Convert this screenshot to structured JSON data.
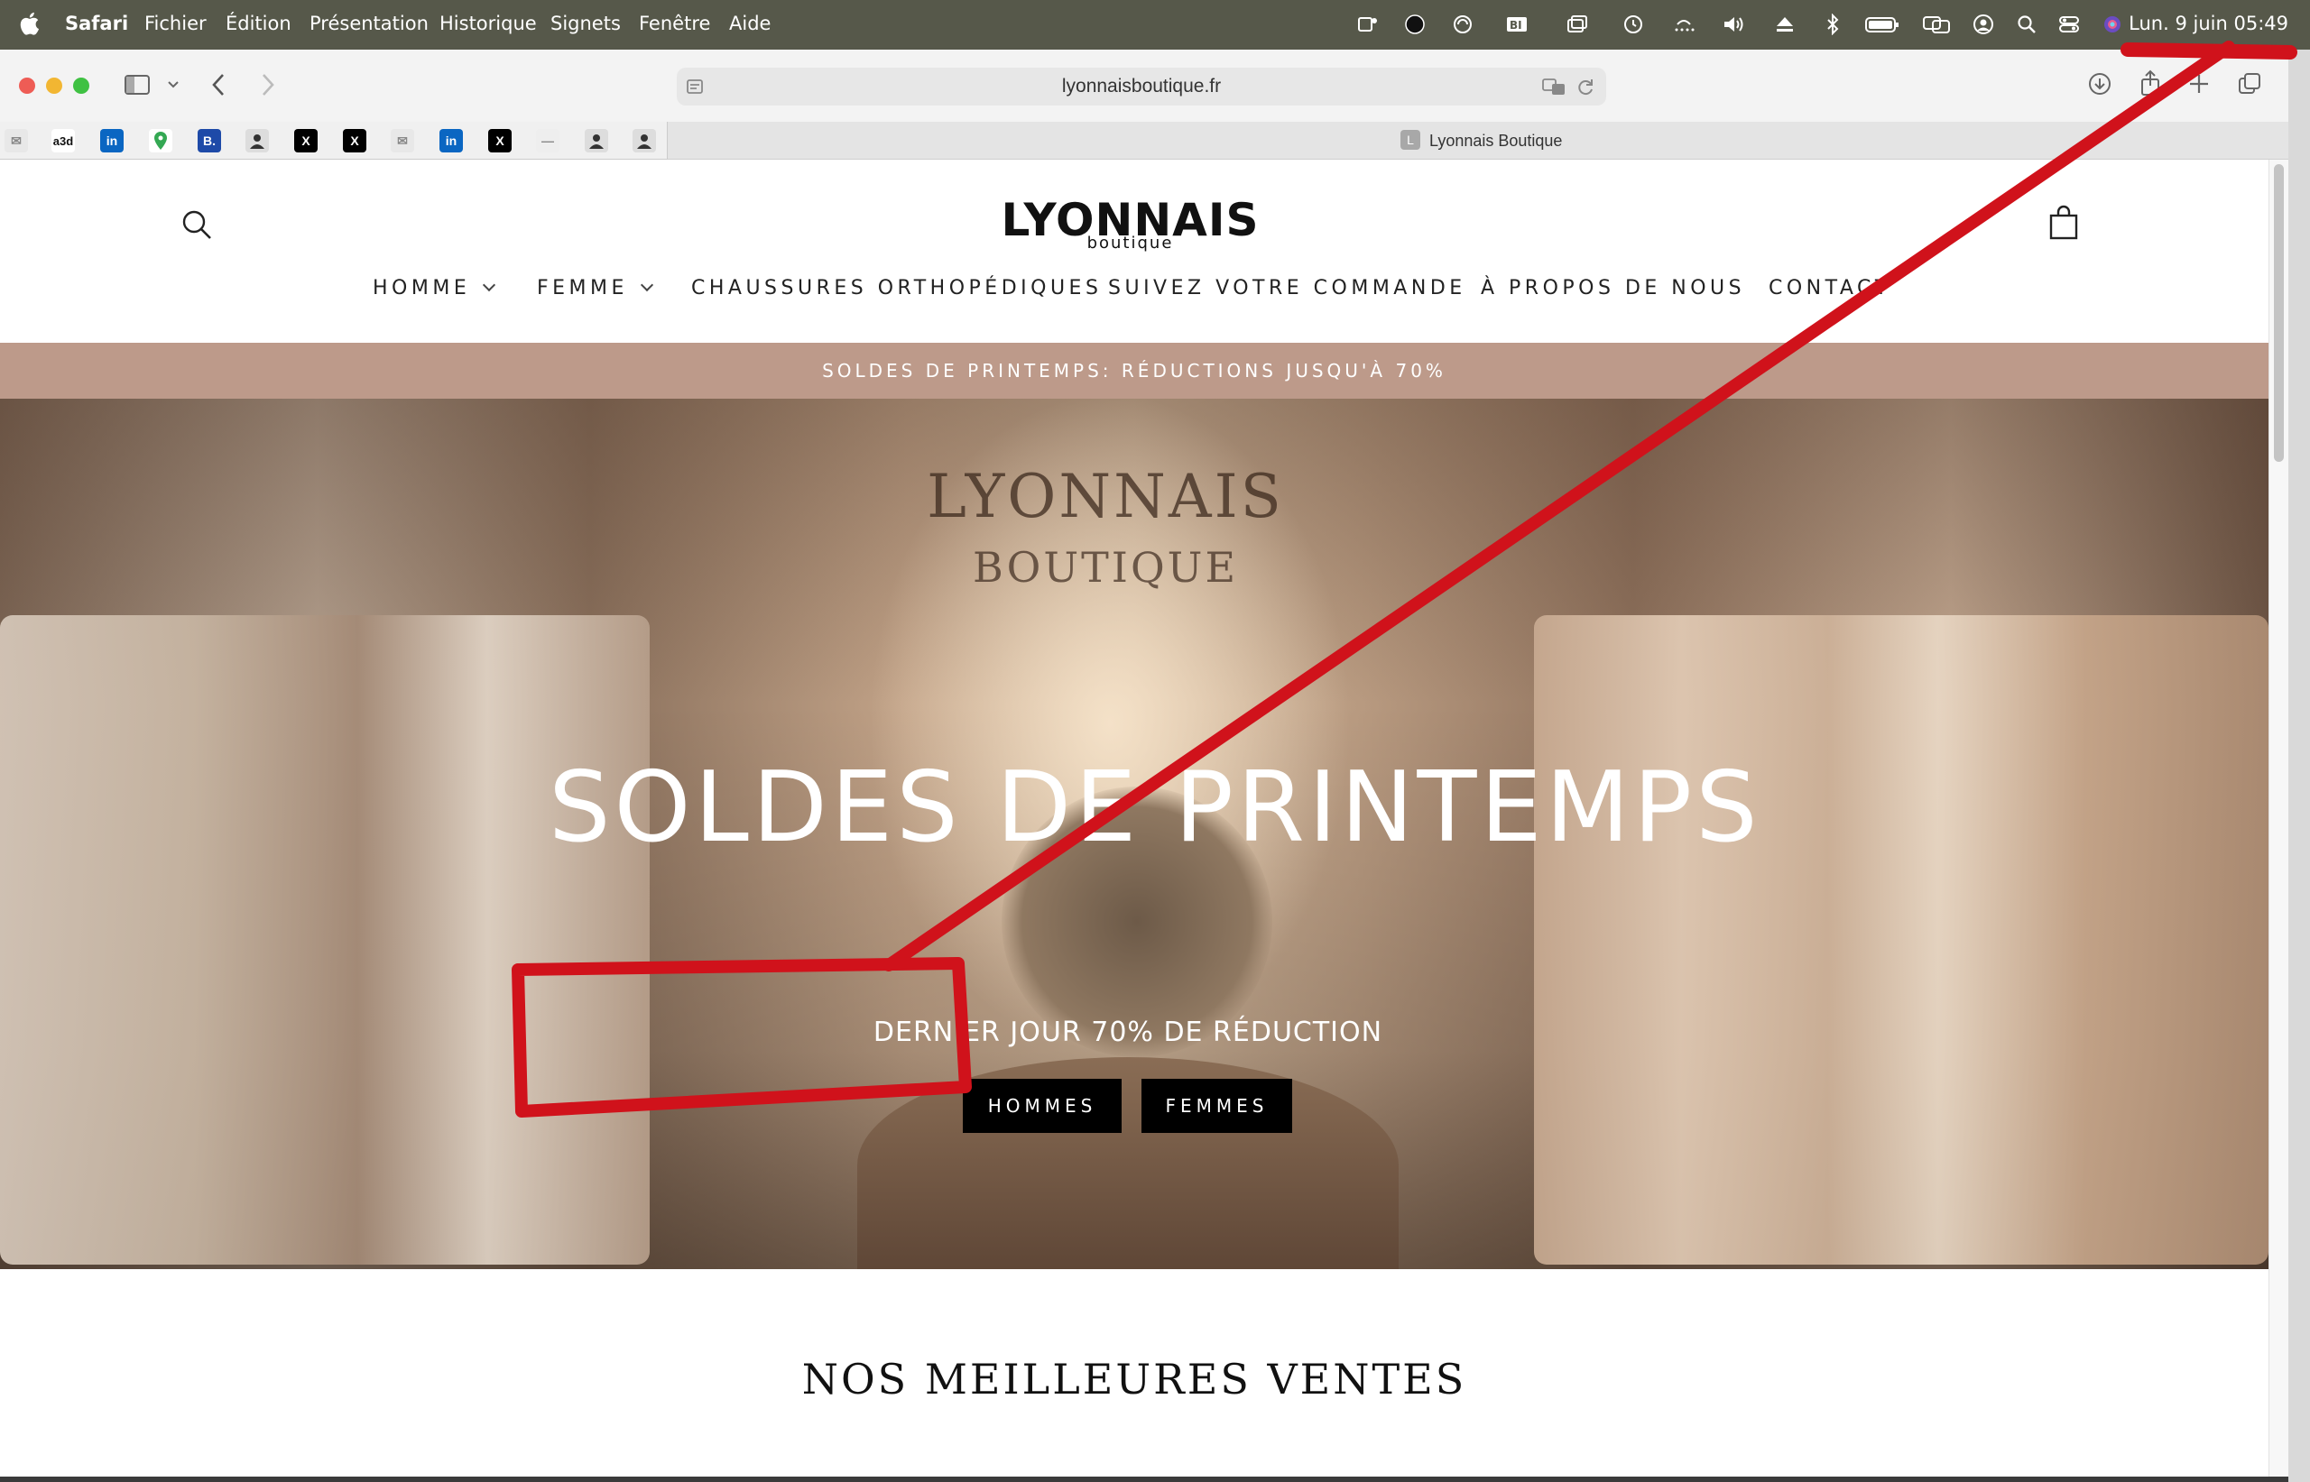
{
  "menubar": {
    "app": "Safari",
    "items": [
      "Fichier",
      "Édition",
      "Présentation",
      "Historique",
      "Signets",
      "Fenêtre",
      "Aide"
    ],
    "clock": "Lun. 9 juin  05:49"
  },
  "browser": {
    "url": "lyonnaisboutique.fr",
    "tab_title": "Lyonnais Boutique",
    "tab_favicon": "L",
    "favorites": [
      "a3d"
    ]
  },
  "site": {
    "logo": "LYONNAIS",
    "logo_sub": "boutique",
    "nav": {
      "homme": "HOMME",
      "femme": "FEMME",
      "ortho": "CHAUSSURES ORTHOPÉDIQUES",
      "suivez": "SUIVEZ VOTRE COMMANDE",
      "apropos": "À PROPOS DE NOUS",
      "contact": "CONTACT"
    },
    "promo": "SOLDES DE PRINTEMPS: RÉDUCTIONS JUSQU'À 70%",
    "hero": {
      "brand_line1": "LYONNAIS",
      "brand_line2": "BOUTIQUE",
      "title": "SOLDES DE PRINTEMPS",
      "subtitle": "DERNIER JOUR 70% DE RÉDUCTION",
      "btn_hommes": "HOMMES",
      "btn_femmes": "FEMMES"
    },
    "section_title": "NOS MEILLEURES VENTES"
  },
  "colors": {
    "promo_bar": "#bd9a8a",
    "annotation_red": "#d0121b",
    "menubar": "#56584a"
  }
}
